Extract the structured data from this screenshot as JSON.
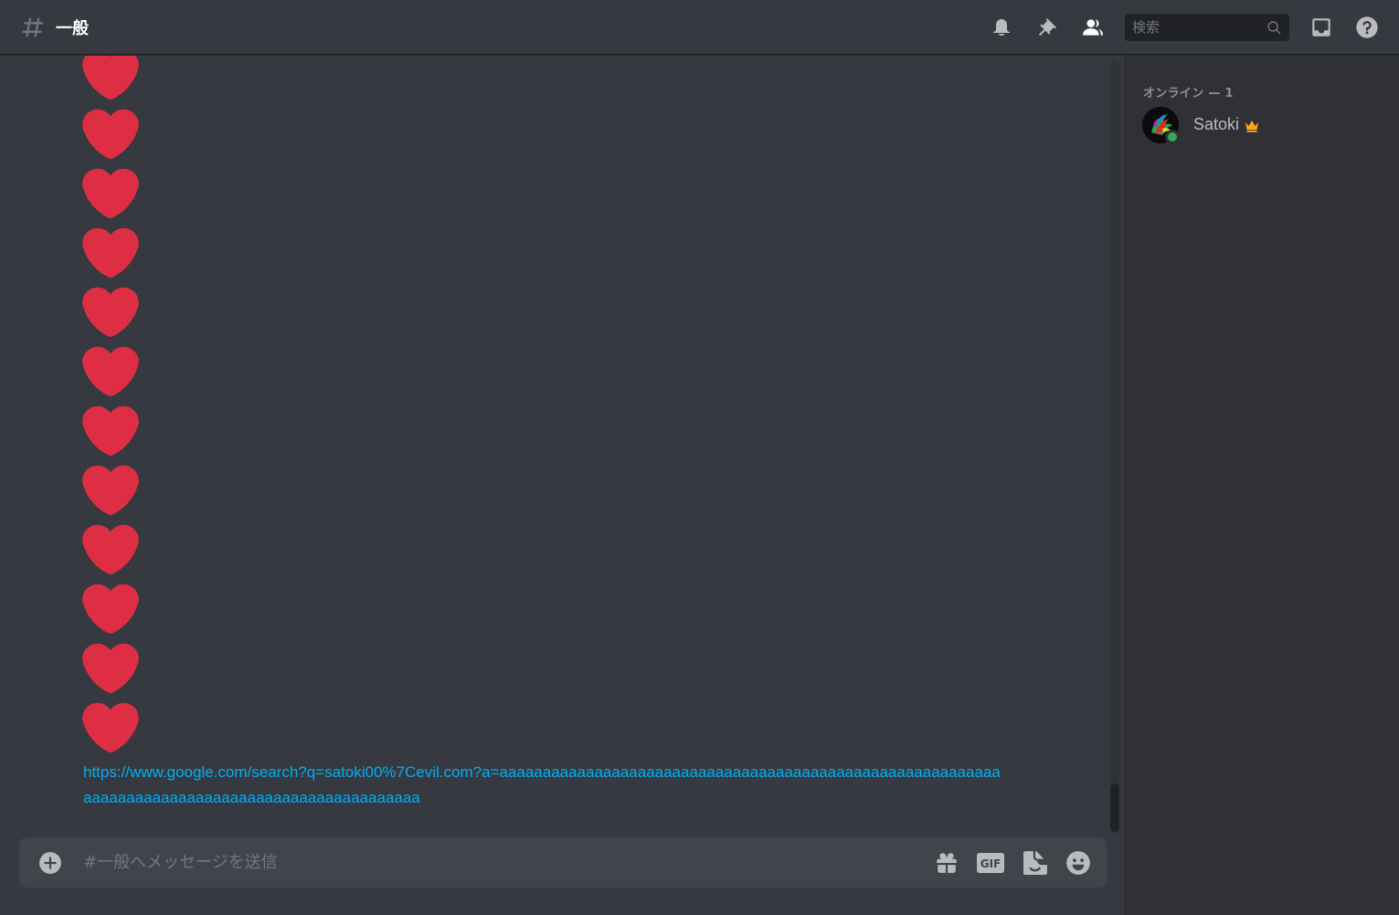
{
  "header": {
    "channel_name": "一般",
    "search_placeholder": "検索"
  },
  "icons": {
    "channel": "hash-icon",
    "notifications": "bell-icon",
    "pins": "pin-icon",
    "members": "members-icon",
    "search": "search-icon",
    "inbox": "inbox-icon",
    "help": "help-icon",
    "attach": "add-circle-icon",
    "gift": "gift-icon",
    "gif": "gif-icon",
    "sticker": "sticker-icon",
    "emoji": "emoji-icon",
    "owner": "crown-icon",
    "message": "heart-emoji"
  },
  "messages": {
    "heart_count": 12,
    "link": "https://www.google.com/search?q=satoki00%7Cevil.com?a=aaaaaaaaaaaaaaaaaaaaaaaaaaaaaaaaaaaaaaaaaaaaaaaaaaaaaaaaaaaaaaaaaaaaaaaaaaaaaaaaaaaaaaaaaaaaaaaaa"
  },
  "composer": {
    "placeholder": "#一般へメッセージを送信",
    "gif_label": "GIF"
  },
  "member_list": {
    "header": "オンライン — 1",
    "members": [
      {
        "name": "Satoki",
        "status": "online",
        "is_owner": true
      }
    ]
  },
  "colors": {
    "background": "#36393f",
    "sidebar": "#2f3136",
    "link": "#00aff4",
    "heart": "#dd2e44",
    "online": "#3ba55d",
    "crown": "#faa61a"
  }
}
